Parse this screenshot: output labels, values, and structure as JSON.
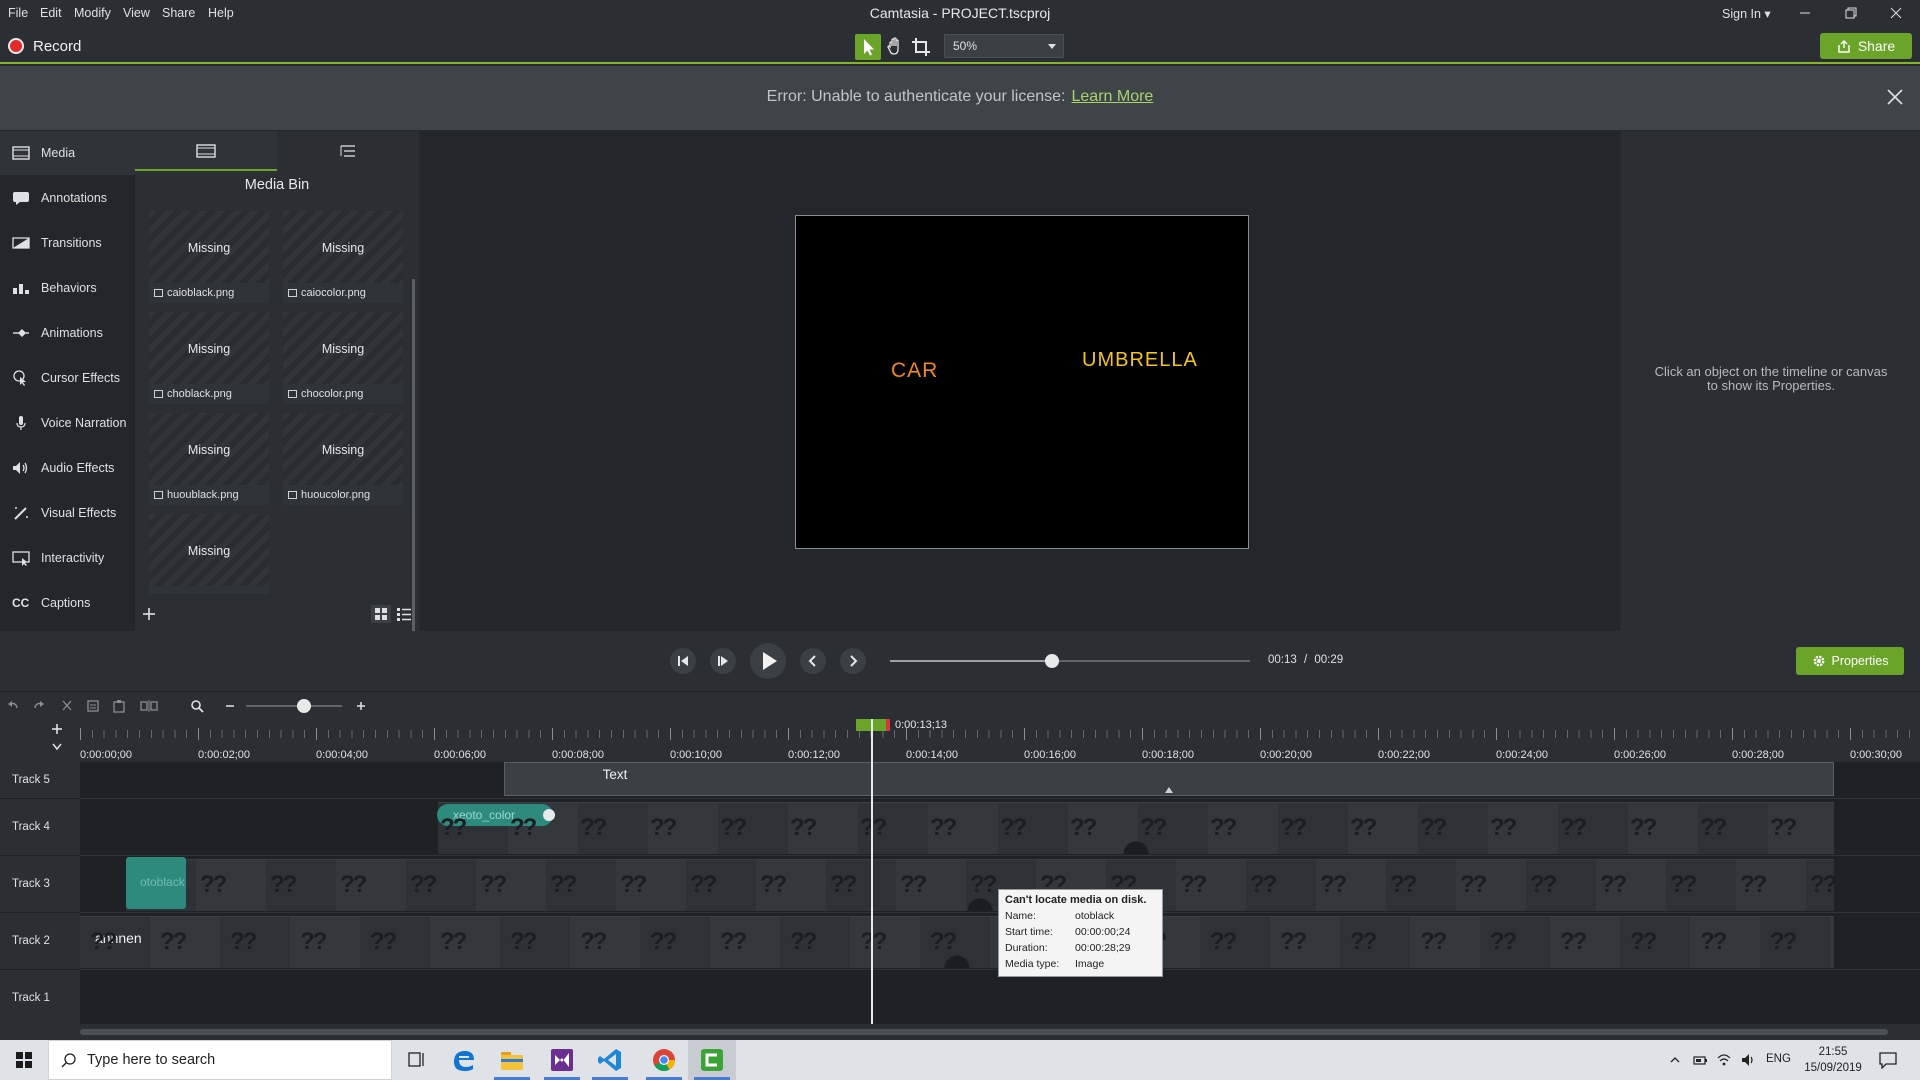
{
  "menu": {
    "items": [
      "File",
      "Edit",
      "Modify",
      "View",
      "Share",
      "Help"
    ],
    "title": "Camtasia - PROJECT.tscproj",
    "signin": "Sign In"
  },
  "toolbar": {
    "record_label": "Record",
    "zoom_value": "50%",
    "share_label": "Share"
  },
  "error": {
    "message": "Error: Unable to authenticate your license:",
    "link": "Learn More"
  },
  "sidebar": {
    "items": [
      {
        "label": "Media",
        "icon": "film-icon"
      },
      {
        "label": "Annotations",
        "icon": "annotation-icon"
      },
      {
        "label": "Transitions",
        "icon": "transition-icon"
      },
      {
        "label": "Behaviors",
        "icon": "behavior-icon"
      },
      {
        "label": "Animations",
        "icon": "animation-icon"
      },
      {
        "label": "Cursor Effects",
        "icon": "cursor-icon"
      },
      {
        "label": "Voice Narration",
        "icon": "microphone-icon"
      },
      {
        "label": "Audio Effects",
        "icon": "speaker-icon"
      },
      {
        "label": "Visual Effects",
        "icon": "wand-icon"
      },
      {
        "label": "Interactivity",
        "icon": "interactivity-icon"
      },
      {
        "label": "Captions",
        "icon": "cc-icon"
      }
    ]
  },
  "mediabin": {
    "title": "Media Bin",
    "missing_label": "Missing",
    "items": [
      {
        "name": "caioblack.png"
      },
      {
        "name": "caiocolor.png"
      },
      {
        "name": "choblack.png"
      },
      {
        "name": "chocolor.png"
      },
      {
        "name": "huoublack.png"
      },
      {
        "name": "huoucolor.png"
      },
      {
        "name": ""
      }
    ]
  },
  "canvas": {
    "text_left": "CAR",
    "text_right": "UMBRELLA",
    "color_left": "#f0881f",
    "color_right": "#f3c41c"
  },
  "properties": {
    "hint": "Click an object on the timeline or canvas to show its Properties.",
    "button": "Properties"
  },
  "playback": {
    "current": "00:13",
    "separator": "/",
    "total": "00:29",
    "progress": 0.45
  },
  "timeline": {
    "zoom_level": 0.6,
    "playhead_time": "0:00:13;13",
    "ticks": [
      "0:00:00;00",
      "0:00:02;00",
      "0:00:04;00",
      "0:00:06;00",
      "0:00:08;00",
      "0:00:10;00",
      "0:00:12;00",
      "0:00:14;00",
      "0:00:16;00",
      "0:00:18;00",
      "0:00:20;00",
      "0:00:22;00",
      "0:00:24;00",
      "0:00:26;00",
      "0:00:28;00",
      "0:00:30;00"
    ],
    "tracks": [
      "Track 5",
      "Track 4",
      "Track 3",
      "Track 2",
      "Track 1"
    ],
    "clips": {
      "text": "Text",
      "xeoto": "xeoto_color",
      "otoblack": "otoblack",
      "anhnen": "anhnen"
    }
  },
  "tooltip": {
    "header": "Can't locate media on disk.",
    "rows": [
      {
        "k": "Name:",
        "v": "otoblack"
      },
      {
        "k": "Start time:",
        "v": "00:00:00;24"
      },
      {
        "k": "Duration:",
        "v": "00:00:28;29"
      },
      {
        "k": "Media type:",
        "v": "Image"
      }
    ]
  },
  "taskbar": {
    "search_placeholder": "Type here to search",
    "lang": "ENG",
    "time": "21:55",
    "date": "15/09/2019"
  },
  "colors": {
    "accent": "#6aa52a",
    "record": "#e32b2b",
    "clip_teal": "#2f8a7e"
  }
}
